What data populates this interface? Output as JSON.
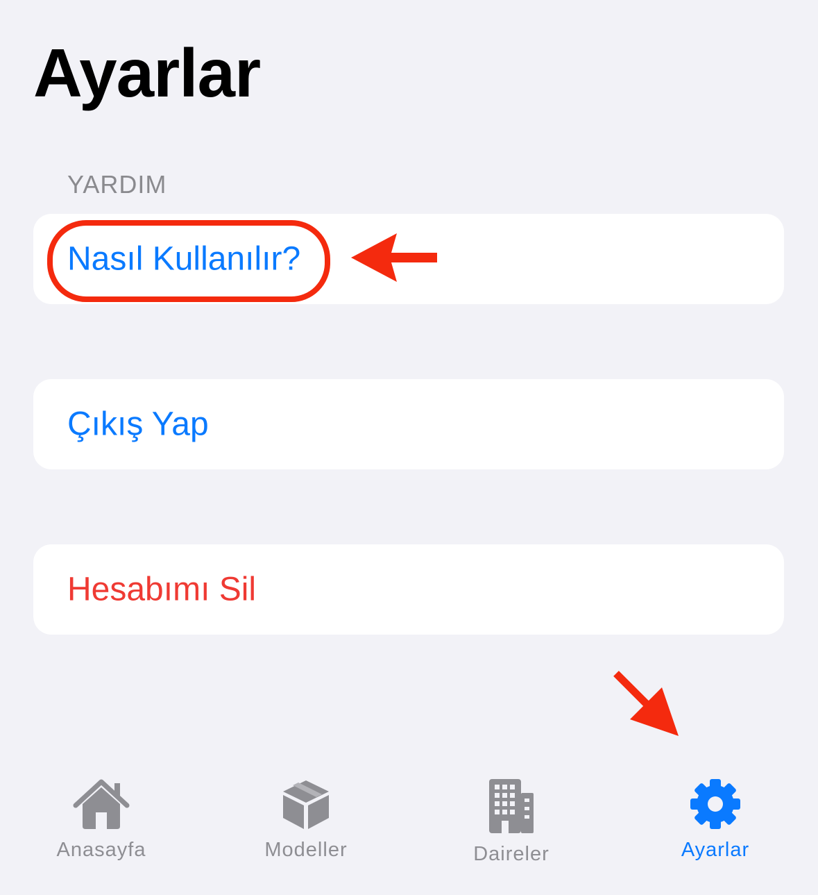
{
  "page": {
    "title": "Ayarlar"
  },
  "sections": {
    "help_header": "YARDIM"
  },
  "rows": {
    "how_to": "Nasıl Kullanılır?",
    "logout": "Çıkış Yap",
    "delete_account": "Hesabımı Sil"
  },
  "tabbar": {
    "home": "Anasayfa",
    "models": "Modeller",
    "flats": "Daireler",
    "settings": "Ayarlar",
    "selected": "settings"
  },
  "icons": {
    "home": "house-icon",
    "models": "cube-box-icon",
    "flats": "building-icon",
    "settings": "gear-icon"
  },
  "colors": {
    "accent": "#0a7aff",
    "destructive": "#ef3a33",
    "annotation": "#f42a0e",
    "tab_inactive": "#8e8e93",
    "background": "#f2f2f7"
  }
}
